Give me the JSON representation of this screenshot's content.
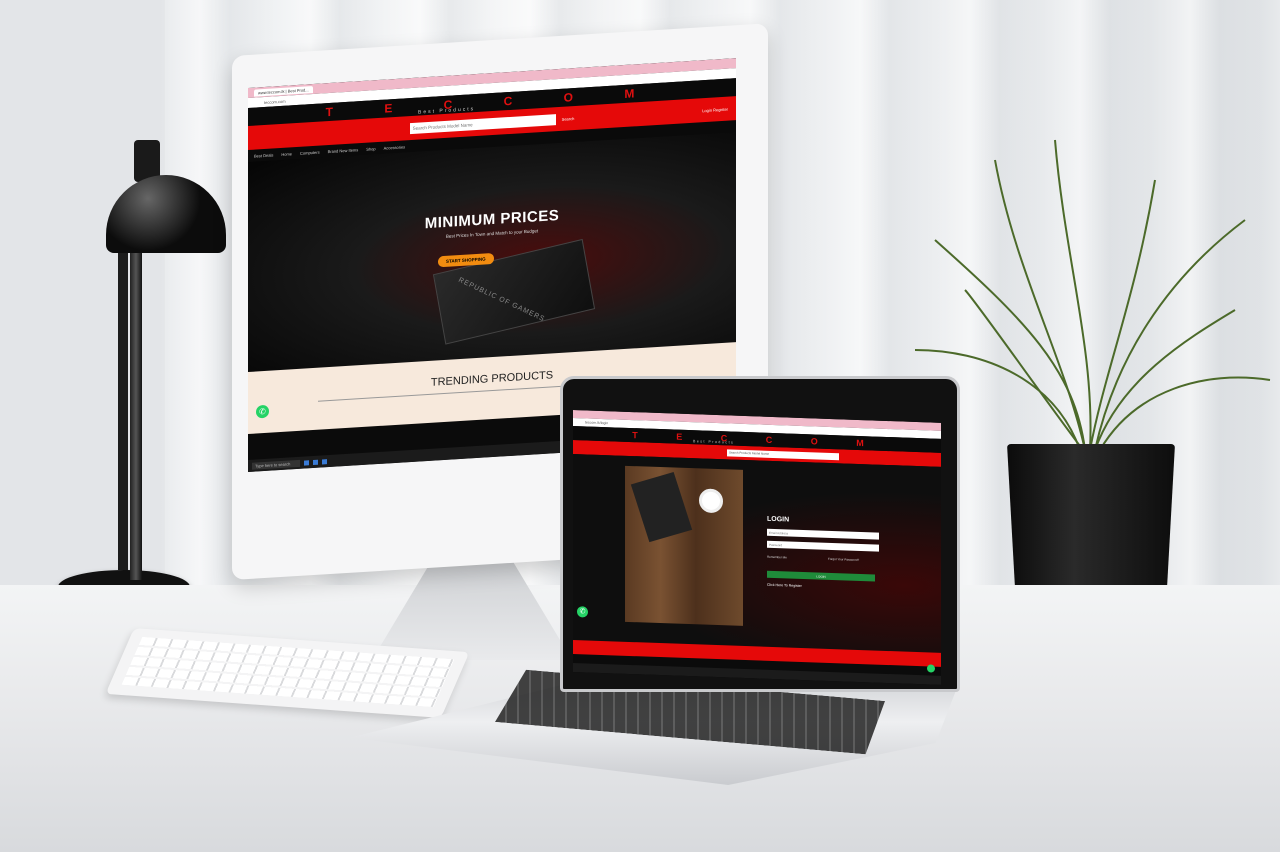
{
  "monitor_site": {
    "tab_title": "www.teccom.lk | Best Prod...",
    "url": "teccom.com",
    "logo": "T E C C O M",
    "tagline": "Best Products",
    "search_placeholder": "Search Products Model Name",
    "search_button": "Search",
    "header_links": "Login  Register",
    "nav_items": [
      "Best Deals",
      "Home",
      "Computers",
      "Brand New Items",
      "Shop",
      "Accessories"
    ],
    "hero_title": "MINIMUM PRICES",
    "hero_subtitle": "Best Prices In Town and Match to your Budget",
    "hero_button": "START SHOPPING",
    "chip_text": "REPUBLIC OF GAMERS",
    "trending_title": "TRENDING PRODUCTS",
    "taskbar_search": "Type here to search"
  },
  "laptop_site": {
    "url": "teccom.lk/login",
    "logo": "T E C C O M",
    "tagline": "Best Products",
    "search_placeholder": "Search Products Model Name",
    "login_title": "LOGIN",
    "email_placeholder": "Email Address",
    "password_placeholder": "Password",
    "remember_me": "Remember Me",
    "forgot_password": "Forgot Your Password?",
    "login_button": "LOGIN",
    "register_link": "Click Here To Register"
  },
  "colors": {
    "brand_red": "#e50909",
    "brand_black": "#0a0a0a",
    "accent_orange": "#f28c10",
    "success_green": "#1f8b3a",
    "whatsapp_green": "#25d366"
  },
  "icons": [
    "whatsapp-icon",
    "lamp",
    "plant"
  ]
}
